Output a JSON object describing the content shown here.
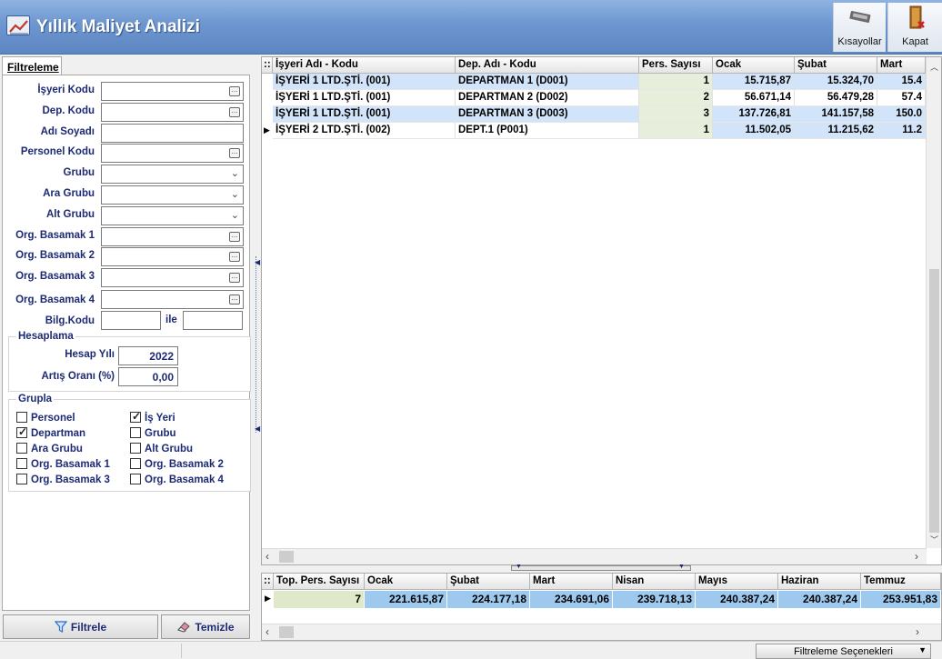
{
  "header": {
    "title": "Yıllık Maliyet Analizi",
    "shortcuts_label": "Kısayollar",
    "close_label": "Kapat"
  },
  "filter": {
    "tab_label": "Filtreleme",
    "fields": [
      {
        "label": "İşyeri Kodu",
        "type": "lookup",
        "value": ""
      },
      {
        "label": "Dep. Kodu",
        "type": "lookup",
        "value": ""
      },
      {
        "label": "Adı Soyadı",
        "type": "text",
        "value": ""
      },
      {
        "label": "Personel Kodu",
        "type": "lookup",
        "value": ""
      },
      {
        "label": "Grubu",
        "type": "select",
        "value": ""
      },
      {
        "label": "Ara Grubu",
        "type": "select",
        "value": ""
      },
      {
        "label": "Alt Grubu",
        "type": "select",
        "value": ""
      },
      {
        "label": "Org. Basamak 1",
        "type": "lookup",
        "value": ""
      },
      {
        "label": "Org. Basamak 2",
        "type": "lookup",
        "value": ""
      },
      {
        "label": "Org. Basamak 3",
        "type": "lookup",
        "value": ""
      },
      {
        "label": "Org. Basamak 4",
        "type": "lookup",
        "value": ""
      }
    ],
    "bilg_label": "Bilg.Kodu",
    "bilg_sep": "ile",
    "hesaplama": {
      "title": "Hesaplama",
      "year_label": "Hesap Yılı",
      "year_value": "2022",
      "rate_label": "Artış Oranı (%)",
      "rate_value": "0,00"
    },
    "grupla": {
      "title": "Grupla",
      "options": [
        {
          "label": "Personel",
          "checked": false
        },
        {
          "label": "İş Yeri",
          "checked": true
        },
        {
          "label": "Departman",
          "checked": true
        },
        {
          "label": "Grubu",
          "checked": false
        },
        {
          "label": "Ara Grubu",
          "checked": false
        },
        {
          "label": "Alt Grubu",
          "checked": false
        },
        {
          "label": "Org. Basamak 1",
          "checked": false
        },
        {
          "label": "Org. Basamak 2",
          "checked": false
        },
        {
          "label": "Org. Basamak 3",
          "checked": false
        },
        {
          "label": "Org. Basamak 4",
          "checked": false
        }
      ]
    },
    "filter_button": "Filtrele",
    "clear_button": "Temizle"
  },
  "grid": {
    "columns": [
      "İşyeri Adı - Kodu",
      "Dep. Adı - Kodu",
      "Pers. Sayısı",
      "Ocak",
      "Şubat",
      "Mart"
    ],
    "rows": [
      [
        "İŞYERİ 1 LTD.ŞTİ. (001)",
        "DEPARTMAN 1 (D001)",
        "1",
        "15.715,87",
        "15.324,70",
        "15.4"
      ],
      [
        "İŞYERİ 1 LTD.ŞTİ. (001)",
        "DEPARTMAN 2 (D002)",
        "2",
        "56.671,14",
        "56.479,28",
        "57.4"
      ],
      [
        "İŞYERİ 1 LTD.ŞTİ. (001)",
        "DEPARTMAN 3 (D003)",
        "3",
        "137.726,81",
        "141.157,58",
        "150.0"
      ],
      [
        "İŞYERİ 2 LTD.ŞTİ. (002)",
        "DEPT.1 (P001)",
        "1",
        "11.502,05",
        "11.215,62",
        "11.2"
      ]
    ],
    "current_row": 3
  },
  "summary": {
    "columns": [
      "Top. Pers. Sayısı",
      "Ocak",
      "Şubat",
      "Mart",
      "Nisan",
      "Mayıs",
      "Haziran",
      "Temmuz"
    ],
    "values": [
      "7",
      "221.615,87",
      "224.177,18",
      "234.691,06",
      "239.718,13",
      "240.387,24",
      "240.387,24",
      "253.951,83"
    ]
  },
  "status": {
    "filter_options_label": "Filtreleme Seçenekleri"
  }
}
